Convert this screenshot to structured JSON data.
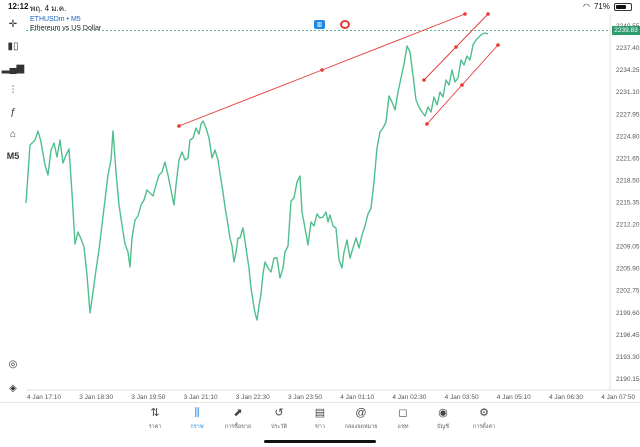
{
  "status_bar": {
    "time": "12:12",
    "date": "พฤ. 4 ม.ค.",
    "battery": "71%",
    "battery_level": 0.71
  },
  "toolbar": {
    "timeframe": "M5"
  },
  "symbol": {
    "name": "ETHUSDm • M5",
    "description": "Ethereum vs US Dollar"
  },
  "current_price": "2239.83",
  "colors": {
    "price_line": "#4fbf8e",
    "trendline": "#e53935",
    "accent": "#1e88e5",
    "current_price_bg": "#2e9c6e"
  },
  "chart_data": {
    "type": "line",
    "y_ticks": [
      "2240.55",
      "2237.40",
      "2234.25",
      "2231.10",
      "2227.95",
      "2224.80",
      "2221.65",
      "2218.50",
      "2215.35",
      "2212.20",
      "2209.05",
      "2205.90",
      "2202.75",
      "2199.60",
      "2196.45",
      "2193.30",
      "2190.15"
    ],
    "x_ticks": [
      "4 Jan 17:10",
      "3 Jan 18:30",
      "3 Jan 19:50",
      "3 Jan 21:10",
      "3 Jan 22:30",
      "3 Jan 23:50",
      "4 Jan 01:10",
      "4 Jan 02:30",
      "4 Jan 03:50",
      "4 Jan 05:10",
      "4 Jan 06:30",
      "4 Jan 07:50"
    ],
    "ylim": [
      2188.5,
      2242.2
    ],
    "grid": false
  },
  "nav": [
    {
      "label": "ราคา",
      "icon": "⇅",
      "icon_name": "quotes-icon",
      "active": false
    },
    {
      "label": "กราฟ",
      "icon": "⫼",
      "icon_name": "chart-icon",
      "active": true
    },
    {
      "label": "การซื้อขาย",
      "icon": "⬈",
      "icon_name": "trade-icon",
      "active": false
    },
    {
      "label": "ประวัติ",
      "icon": "↺",
      "icon_name": "history-icon",
      "active": false
    },
    {
      "label": "ข่าว",
      "icon": "▤",
      "icon_name": "news-icon",
      "active": false
    },
    {
      "label": "กล่องจดหมาย",
      "icon": "@",
      "icon_name": "mailbox-icon",
      "active": false
    },
    {
      "label": "แชท",
      "icon": "◻",
      "icon_name": "chat-icon",
      "active": false
    },
    {
      "label": "บัญชี",
      "icon": "◉",
      "icon_name": "account-icon",
      "active": false
    },
    {
      "label": "การตั้งค่า",
      "icon": "⚙",
      "icon_name": "settings-icon",
      "active": false
    }
  ]
}
